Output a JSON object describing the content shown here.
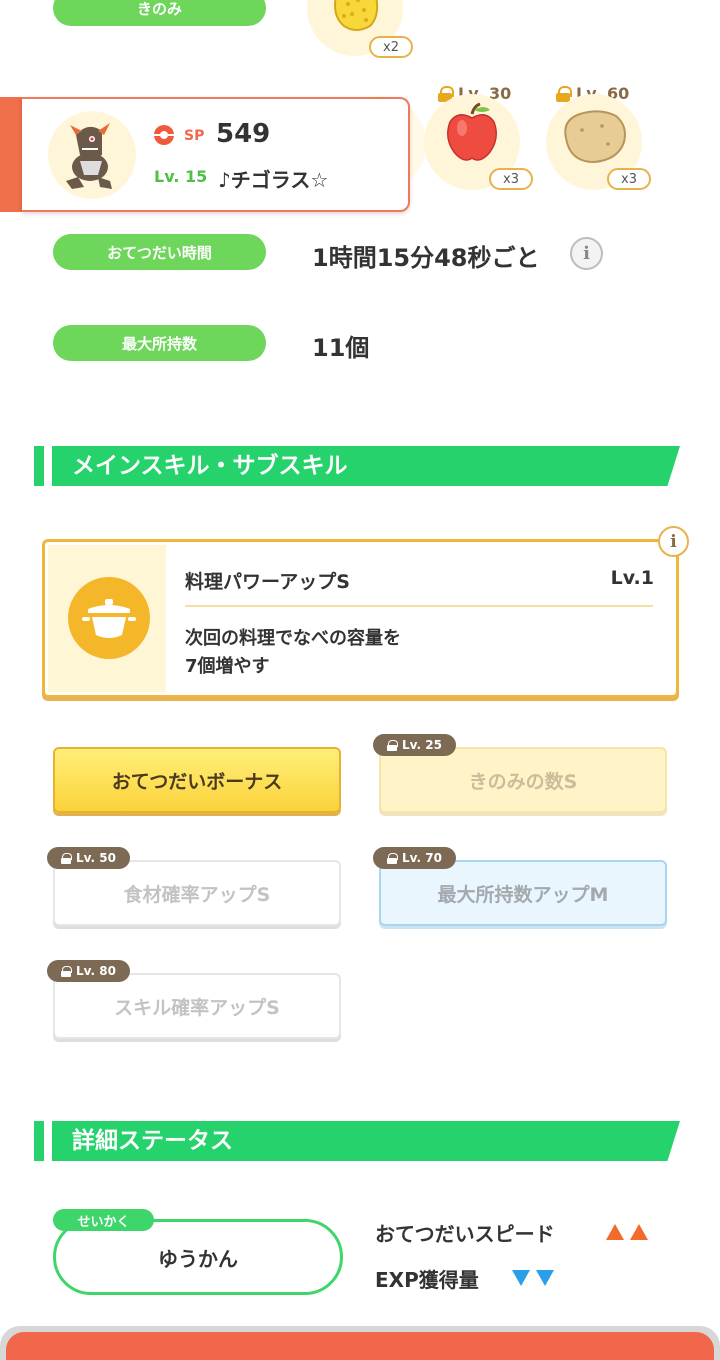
{
  "berry": {
    "label": "きのみ",
    "qty": "x2"
  },
  "pokemon_card": {
    "sp_label": "SP",
    "sp_value": "549",
    "level": "Lv. 15",
    "name": "♪チゴラス☆"
  },
  "ingredients": [
    {
      "name": "apple-icon",
      "lock_level": "Lv. 30",
      "qty": "x3"
    },
    {
      "name": "potato-icon",
      "lock_level": "Lv. 60",
      "qty": "x3"
    }
  ],
  "help_time": {
    "label": "おてつだい時間",
    "value": "1時間15分48秒ごと"
  },
  "max_carry": {
    "label": "最大所持数",
    "value": "11個"
  },
  "skills_section": {
    "title": "メインスキル・サブスキル"
  },
  "main_skill": {
    "name": "料理パワーアップS",
    "level": "Lv.1",
    "description_line1": "次回の料理でなべの容量を",
    "description_line2": "7個増やす",
    "icon": "pot-icon"
  },
  "sub_skills": [
    {
      "label": "おてつだいボーナス",
      "lock": "",
      "state": "active"
    },
    {
      "label": "きのみの数S",
      "lock": "Lv. 25",
      "state": "locked"
    },
    {
      "label": "食材確率アップS",
      "lock": "Lv. 50",
      "state": "locked"
    },
    {
      "label": "最大所持数アップM",
      "lock": "Lv. 70",
      "state": "locked"
    },
    {
      "label": "スキル確率アップS",
      "lock": "Lv. 80",
      "state": "locked"
    }
  ],
  "details_section": {
    "title": "詳細ステータス"
  },
  "nature": {
    "tag": "せいかく",
    "value": "ゆうかん",
    "up_stat": "おてつだいスピード",
    "down_stat": "EXP獲得量",
    "up_color": "#f26a2c",
    "down_color": "#2a9ee8"
  },
  "colors": {
    "accent_green": "#26d26b",
    "pill_green": "#6ed65a",
    "card_border": "#f0795a",
    "skill_border": "#f0b53a",
    "bottom_bar": "#f0674c"
  }
}
